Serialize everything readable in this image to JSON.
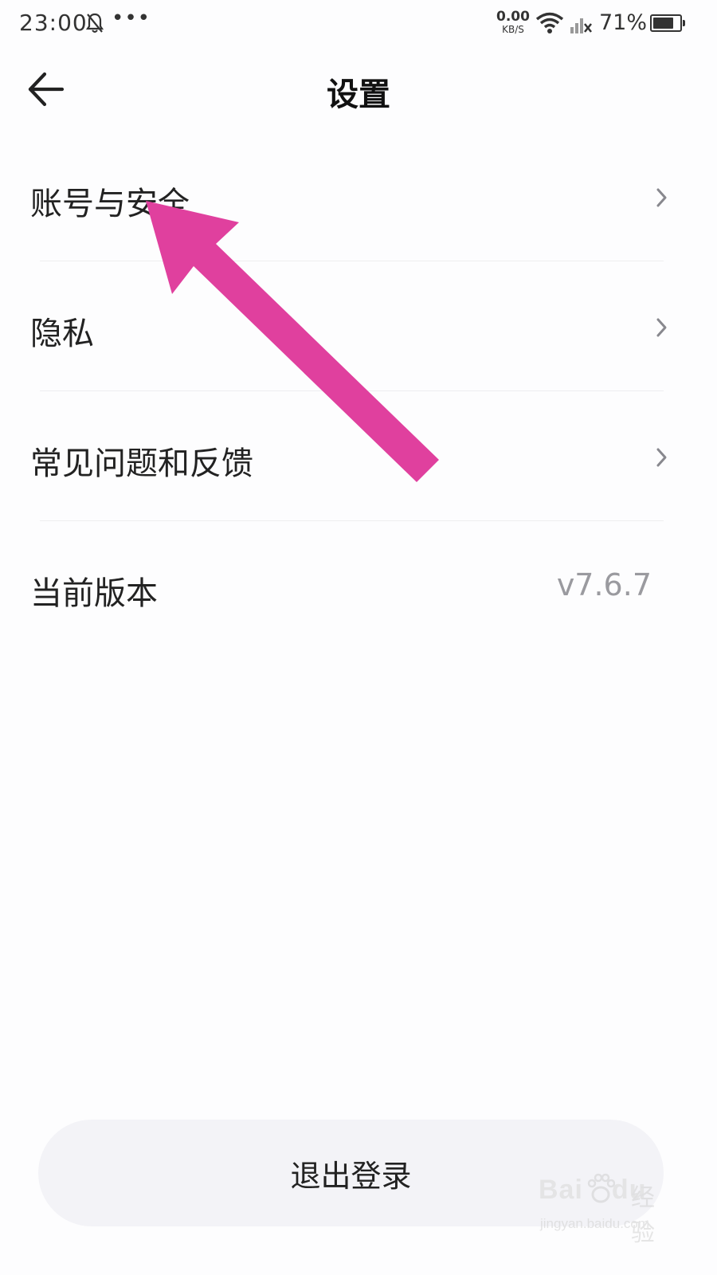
{
  "status_bar": {
    "time": "23:00",
    "more": "•••",
    "net_speed_value": "0.00",
    "net_speed_unit": "KB/S",
    "battery_percent": "71%",
    "icons": [
      "bell-off-icon",
      "more-icon",
      "wifi-icon",
      "signal-off-icon",
      "battery-icon"
    ]
  },
  "header": {
    "title": "设置",
    "back_icon": "back-arrow-icon"
  },
  "settings": {
    "items": [
      {
        "label": "账号与安全",
        "icon": "chevron-right-icon"
      },
      {
        "label": "隐私",
        "icon": "chevron-right-icon"
      },
      {
        "label": "常见问题和反馈",
        "icon": "chevron-right-icon"
      },
      {
        "label": "当前版本",
        "value": "v7.6.7"
      }
    ]
  },
  "logout": {
    "label": "退出登录"
  },
  "annotation": {
    "arrow_color": "#e0409e"
  },
  "watermark": {
    "logo_text": "Bai",
    "logo_suffix": "du",
    "brand_cn": "经验",
    "url": "jingyan.baidu.com"
  },
  "colors": {
    "background": "#fdfdfe",
    "text_primary": "#222222",
    "text_secondary": "#9a9a9f",
    "divider": "#eeeef0",
    "logout_bg": "#f3f3f7"
  }
}
